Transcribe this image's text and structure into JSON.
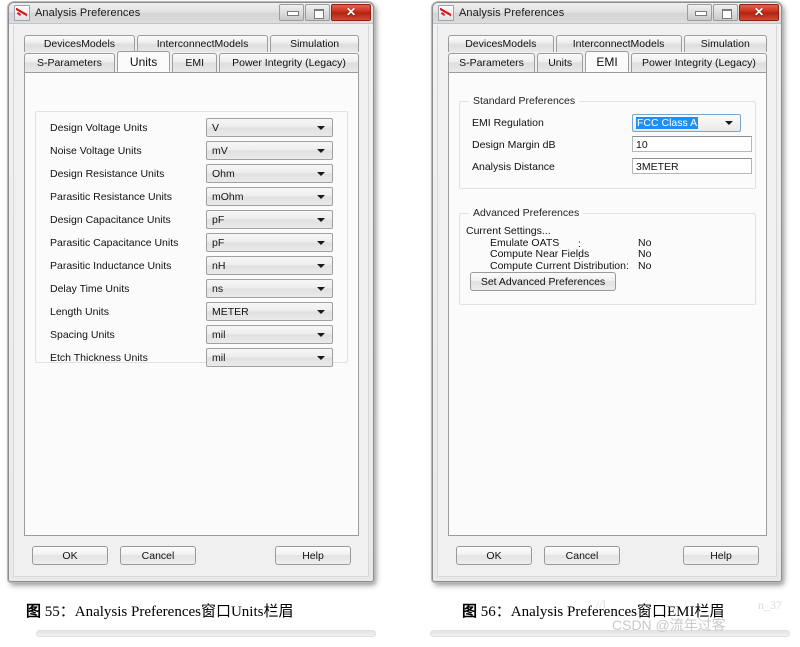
{
  "page": {
    "watermark": "CSDN @流年过客",
    "ghost_text_left": "//l",
    "ghost_text_right": "n_37"
  },
  "captions": {
    "left": {
      "prefix": "图",
      "number": "55",
      "text": "：Analysis Preferences窗口Units栏眉"
    },
    "right": {
      "prefix": "图",
      "number": "56",
      "text": "：Analysis Preferences窗口EMI栏眉"
    }
  },
  "dialog_left": {
    "title": "Analysis Preferences",
    "icon": "app-icon",
    "caption_buttons": {
      "minimize": "minimize-icon",
      "maximize": "maximize-icon",
      "close": "✕"
    },
    "tabs_row1": [
      {
        "label": "DevicesModels",
        "active": false
      },
      {
        "label": "InterconnectModels",
        "active": false
      },
      {
        "label": "Simulation",
        "active": false
      }
    ],
    "tabs_row2": [
      {
        "label": "S-Parameters",
        "active": false
      },
      {
        "label": "Units",
        "active": true
      },
      {
        "label": "EMI",
        "active": false
      },
      {
        "label": "Power Integrity (Legacy)",
        "active": false
      }
    ],
    "unit_rows": [
      {
        "label": "Design Voltage Units",
        "value": "V"
      },
      {
        "label": "Noise Voltage Units",
        "value": "mV"
      },
      {
        "label": "Design Resistance Units",
        "value": "Ohm"
      },
      {
        "label": "Parasitic Resistance Units",
        "value": "mOhm"
      },
      {
        "label": "Design Capacitance Units",
        "value": "pF"
      },
      {
        "label": "Parasitic Capacitance Units",
        "value": "pF"
      },
      {
        "label": "Parasitic Inductance Units",
        "value": "nH"
      },
      {
        "label": "Delay Time Units",
        "value": "ns"
      },
      {
        "label": "Length Units",
        "value": "METER"
      },
      {
        "label": "Spacing Units",
        "value": "mil"
      },
      {
        "label": "Etch Thickness Units",
        "value": "mil"
      }
    ],
    "buttons": {
      "ok": "OK",
      "cancel": "Cancel",
      "help": "Help"
    }
  },
  "dialog_right": {
    "title": "Analysis Preferences",
    "icon": "app-icon",
    "caption_buttons": {
      "minimize": "minimize-icon",
      "maximize": "maximize-icon",
      "close": "✕"
    },
    "tabs_row1": [
      {
        "label": "DevicesModels",
        "active": false
      },
      {
        "label": "InterconnectModels",
        "active": false
      },
      {
        "label": "Simulation",
        "active": false
      }
    ],
    "tabs_row2": [
      {
        "label": "S-Parameters",
        "active": false
      },
      {
        "label": "Units",
        "active": false
      },
      {
        "label": "EMI",
        "active": true
      },
      {
        "label": "Power Integrity (Legacy)",
        "active": false
      }
    ],
    "standard": {
      "legend": "Standard Preferences",
      "emi_regulation_label": "EMI Regulation",
      "emi_regulation_value": "FCC Class A",
      "design_margin_label": "Design Margin dB",
      "design_margin_value": "10",
      "analysis_distance_label": "Analysis Distance",
      "analysis_distance_value": "3METER"
    },
    "advanced": {
      "legend": "Advanced Preferences",
      "current_settings_label": "Current Settings...",
      "settings": [
        {
          "name": "Emulate OATS",
          "sep": ":",
          "value": "No"
        },
        {
          "name": "Compute Near Fields",
          "sep": ":",
          "value": "No"
        },
        {
          "name": "Compute Current Distribution:",
          "sep": "",
          "value": "No"
        }
      ],
      "set_button": "Set Advanced Preferences"
    },
    "buttons": {
      "ok": "OK",
      "cancel": "Cancel",
      "help": "Help"
    }
  },
  "colors": {
    "selection_blue": "#1e90f5",
    "close_red": "#c52b18",
    "window_bg": "#f0f0f0",
    "panel_bg": "#fbfbfb"
  }
}
